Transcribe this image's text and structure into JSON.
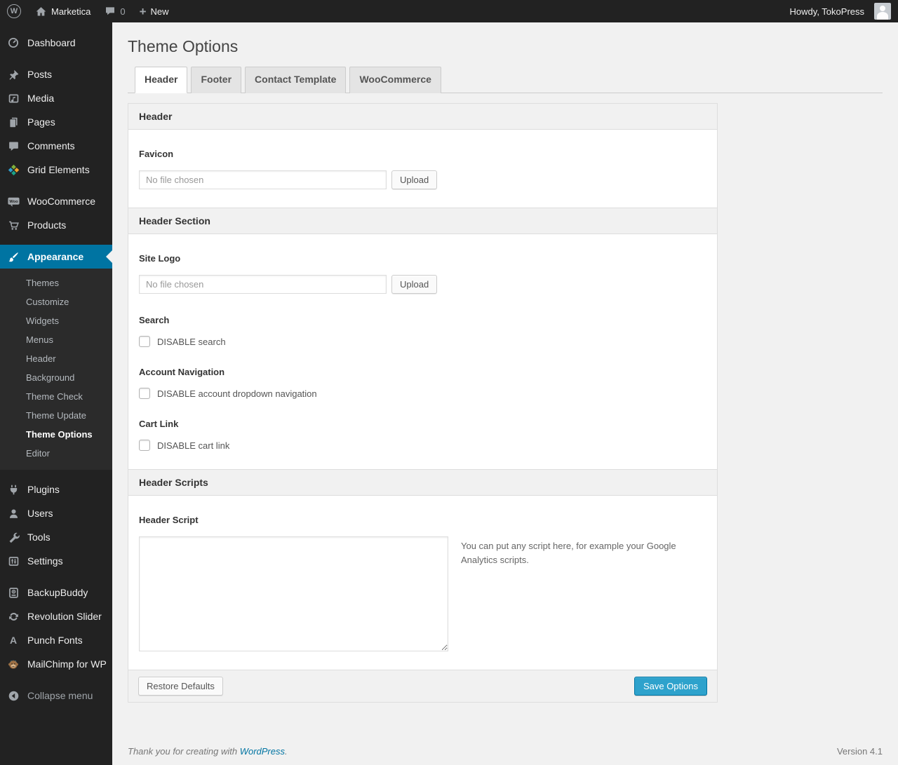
{
  "admin_bar": {
    "wp_logo_letter": "W",
    "site_name": "Marketica",
    "comments_count": "0",
    "new_plus": "+",
    "new_label": "New",
    "howdy": "Howdy, TokoPress"
  },
  "sidebar": {
    "items": [
      {
        "label": "Dashboard"
      },
      {
        "label": "Posts"
      },
      {
        "label": "Media"
      },
      {
        "label": "Pages"
      },
      {
        "label": "Comments"
      },
      {
        "label": "Grid Elements"
      },
      {
        "label": "WooCommerce"
      },
      {
        "label": "Products"
      },
      {
        "label": "Appearance"
      },
      {
        "label": "Plugins"
      },
      {
        "label": "Users"
      },
      {
        "label": "Tools"
      },
      {
        "label": "Settings"
      },
      {
        "label": "BackupBuddy"
      },
      {
        "label": "Revolution Slider"
      },
      {
        "label": "Punch Fonts"
      },
      {
        "label": "MailChimp for WP"
      }
    ],
    "woo_badge": "Woo",
    "punch_icon_letter": "A",
    "submenu": [
      "Themes",
      "Customize",
      "Widgets",
      "Menus",
      "Header",
      "Background",
      "Theme Check",
      "Theme Update",
      "Theme Options",
      "Editor"
    ],
    "collapse_label": "Collapse menu"
  },
  "page": {
    "title": "Theme Options",
    "tabs": [
      {
        "label": "Header",
        "active": true
      },
      {
        "label": "Footer",
        "active": false
      },
      {
        "label": "Contact Template",
        "active": false
      },
      {
        "label": "WooCommerce",
        "active": false
      }
    ]
  },
  "panel": {
    "section_header_title": "Header",
    "favicon_label": "Favicon",
    "file_placeholder": "No file chosen",
    "upload_label": "Upload",
    "header_section_title": "Header Section",
    "site_logo_label": "Site Logo",
    "search_label": "Search",
    "disable_search_label": "DISABLE search",
    "account_nav_label": "Account Navigation",
    "disable_account_label": "DISABLE account dropdown navigation",
    "cart_link_label": "Cart Link",
    "disable_cart_label": "DISABLE cart link",
    "header_scripts_title": "Header Scripts",
    "header_script_label": "Header Script",
    "script_help": "You can put any script here, for example your Google Analytics scripts.",
    "script_value": "",
    "restore_label": "Restore Defaults",
    "save_label": "Save Options"
  },
  "footer": {
    "thanks_prefix": "Thank you for creating with ",
    "wordpress_link": "WordPress",
    "thanks_suffix": ".",
    "version": "Version 4.1"
  },
  "colors": {
    "accent_blue": "#0074a2",
    "primary_button": "#2ea2cc",
    "menu_bg": "#222222",
    "content_bg": "#f1f1f1"
  }
}
